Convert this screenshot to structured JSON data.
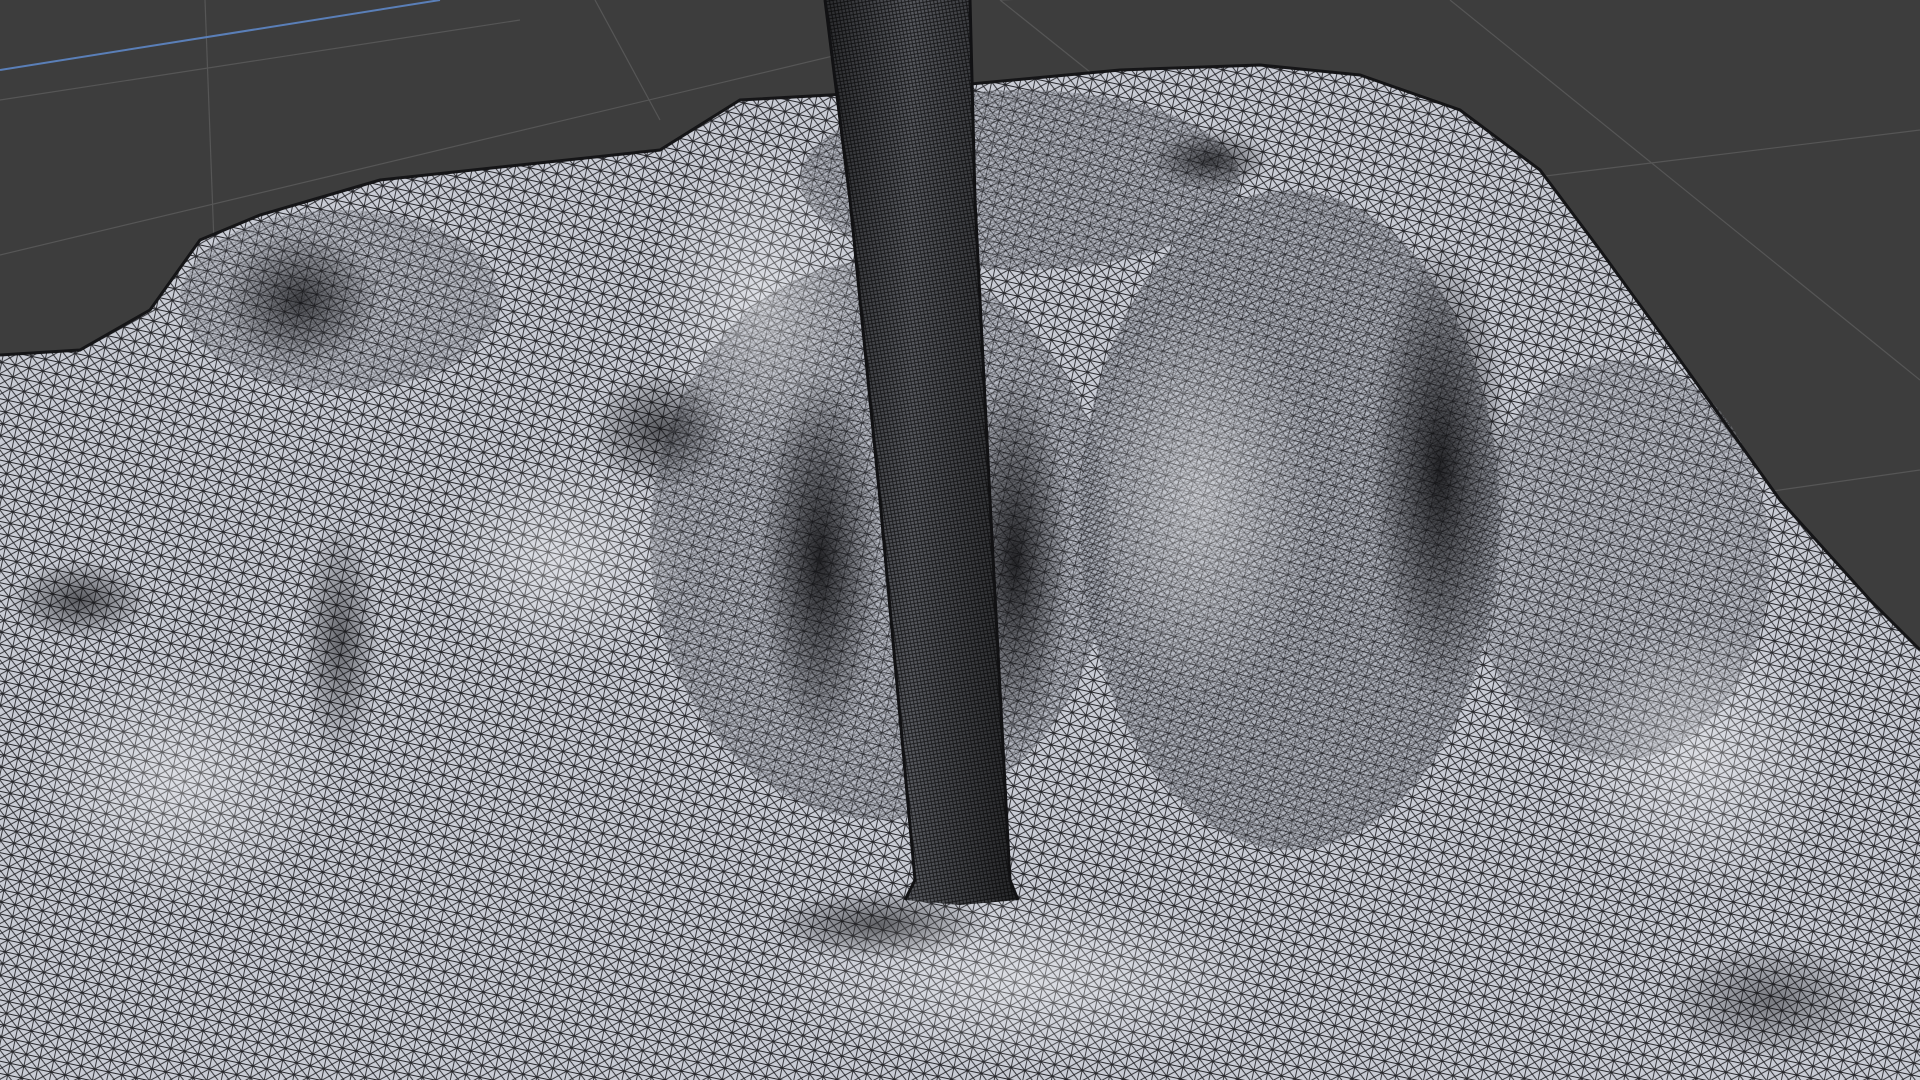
{
  "viewport": {
    "background_color": "#3d3d3d",
    "grid_color": "#555555",
    "axis_color": "#5a7fb8",
    "mesh_fill_color": "#c4c8d2",
    "mesh_line_color": "#1e1e20",
    "display_mode": "wireframe-overlay"
  },
  "scene_objects": [
    {
      "name": "terrain-scan-mesh"
    },
    {
      "name": "vertical-pole-mesh"
    }
  ]
}
